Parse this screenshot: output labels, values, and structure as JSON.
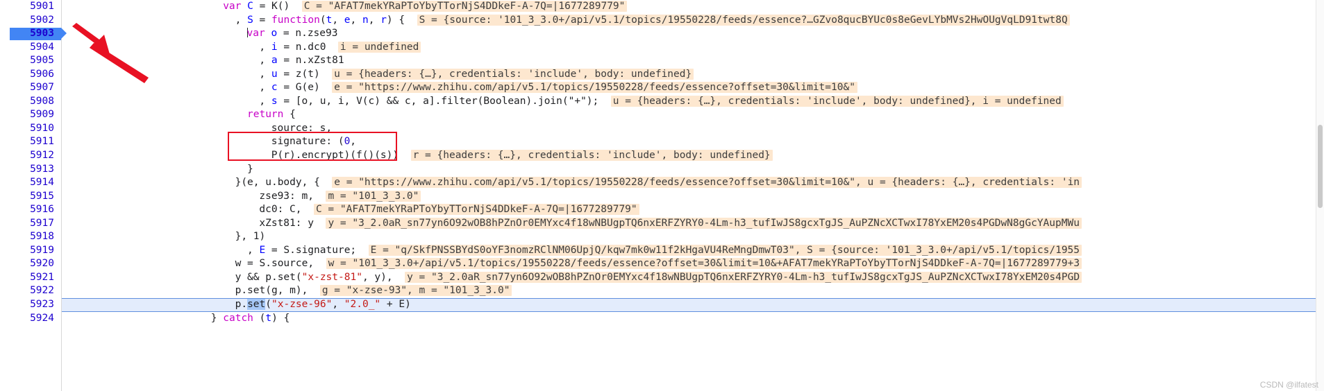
{
  "app": {
    "name": "Chrome DevTools Sources Panel",
    "watermark": "CSDN @ilfatest"
  },
  "editor": {
    "first_line": 5901,
    "current_line": 5923,
    "arrow_target_line": 5903,
    "highlight_box_lines": [
      5911,
      5912
    ],
    "accent_color": "#4285f4",
    "hint_bg": "#fde7cf",
    "selection_color": "#a6c8f7",
    "annotation_color": "#e81123",
    "gutter_numbers": [
      "5901",
      "5902",
      "5903",
      "5904",
      "5905",
      "5906",
      "5907",
      "5908",
      "5909",
      "5910",
      "5911",
      "5912",
      "5913",
      "5914",
      "5915",
      "5916",
      "5917",
      "5918",
      "5919",
      "5920",
      "5921",
      "5922",
      "5923",
      "5924"
    ],
    "lines": [
      {
        "n": "5901",
        "indent": 26,
        "tokens": [
          {
            "t": "kw",
            "v": "var"
          },
          {
            "t": "plain",
            "v": " "
          },
          {
            "t": "var",
            "v": "C"
          },
          {
            "t": "plain",
            "v": " = K()"
          }
        ],
        "hint": "C = \"AFAT7mekYRaPToYbyTTorNjS4DDkeF-A-7Q=|1677289779\""
      },
      {
        "n": "5902",
        "indent": 28,
        "tokens": [
          {
            "t": "plain",
            "v": ", "
          },
          {
            "t": "var",
            "v": "S"
          },
          {
            "t": "plain",
            "v": " = "
          },
          {
            "t": "kw",
            "v": "function"
          },
          {
            "t": "plain",
            "v": "("
          },
          {
            "t": "var",
            "v": "t"
          },
          {
            "t": "plain",
            "v": ", "
          },
          {
            "t": "var",
            "v": "e"
          },
          {
            "t": "plain",
            "v": ", "
          },
          {
            "t": "var",
            "v": "n"
          },
          {
            "t": "plain",
            "v": ", "
          },
          {
            "t": "var",
            "v": "r"
          },
          {
            "t": "plain",
            "v": ") {"
          }
        ],
        "hint": "S = {source: '101_3_3.0+/api/v5.1/topics/19550228/feeds/essence?…GZvo8qucBYUc0s8eGevLYbMVs2HwOUgVqLD91twt8Q"
      },
      {
        "n": "5903",
        "indent": 30,
        "caret": true,
        "tokens": [
          {
            "t": "kw",
            "v": "var"
          },
          {
            "t": "plain",
            "v": " "
          },
          {
            "t": "var",
            "v": "o"
          },
          {
            "t": "plain",
            "v": " = n.zse93"
          }
        ],
        "hint": ""
      },
      {
        "n": "5904",
        "indent": 32,
        "tokens": [
          {
            "t": "plain",
            "v": ", "
          },
          {
            "t": "var",
            "v": "i"
          },
          {
            "t": "plain",
            "v": " = n.dc0"
          }
        ],
        "hint": "i = undefined"
      },
      {
        "n": "5905",
        "indent": 32,
        "tokens": [
          {
            "t": "plain",
            "v": ", "
          },
          {
            "t": "var",
            "v": "a"
          },
          {
            "t": "plain",
            "v": " = n.xZst81"
          }
        ],
        "hint": ""
      },
      {
        "n": "5906",
        "indent": 32,
        "tokens": [
          {
            "t": "plain",
            "v": ", "
          },
          {
            "t": "var",
            "v": "u"
          },
          {
            "t": "plain",
            "v": " = z(t)"
          }
        ],
        "hint": "u = {headers: {…}, credentials: 'include', body: undefined}"
      },
      {
        "n": "5907",
        "indent": 32,
        "tokens": [
          {
            "t": "plain",
            "v": ", "
          },
          {
            "t": "var",
            "v": "c"
          },
          {
            "t": "plain",
            "v": " = G(e)"
          }
        ],
        "hint": "e = \"https://www.zhihu.com/api/v5.1/topics/19550228/feeds/essence?offset=30&limit=10&\""
      },
      {
        "n": "5908",
        "indent": 32,
        "tokens": [
          {
            "t": "plain",
            "v": ", "
          },
          {
            "t": "var",
            "v": "s"
          },
          {
            "t": "plain",
            "v": " = [o, u, i, V(c) && c, a].filter(Boolean).join(\"+\");"
          }
        ],
        "hint": "u = {headers: {…}, credentials: 'include', body: undefined}, i = undefined"
      },
      {
        "n": "5909",
        "indent": 30,
        "tokens": [
          {
            "t": "kw",
            "v": "return"
          },
          {
            "t": "plain",
            "v": " {"
          }
        ],
        "hint": ""
      },
      {
        "n": "5910",
        "indent": 34,
        "tokens": [
          {
            "t": "plain",
            "v": "source: s,"
          }
        ],
        "hint": ""
      },
      {
        "n": "5911",
        "indent": 34,
        "tokens": [
          {
            "t": "plain",
            "v": "signature: ("
          },
          {
            "t": "num",
            "v": "0"
          },
          {
            "t": "plain",
            "v": ","
          }
        ],
        "hint": ""
      },
      {
        "n": "5912",
        "indent": 34,
        "tokens": [
          {
            "t": "plain",
            "v": "P(r).encrypt)(f()(s))"
          }
        ],
        "hint": "r = {headers: {…}, credentials: 'include', body: undefined}"
      },
      {
        "n": "5913",
        "indent": 30,
        "tokens": [
          {
            "t": "plain",
            "v": "}"
          }
        ],
        "hint": ""
      },
      {
        "n": "5914",
        "indent": 28,
        "tokens": [
          {
            "t": "plain",
            "v": "}(e, u.body, {"
          }
        ],
        "hint": "e = \"https://www.zhihu.com/api/v5.1/topics/19550228/feeds/essence?offset=30&limit=10&\", u = {headers: {…}, credentials: 'in"
      },
      {
        "n": "5915",
        "indent": 32,
        "tokens": [
          {
            "t": "plain",
            "v": "zse93: m,"
          }
        ],
        "hint": "m = \"101_3_3.0\""
      },
      {
        "n": "5916",
        "indent": 32,
        "tokens": [
          {
            "t": "plain",
            "v": "dc0: C,"
          }
        ],
        "hint": "C = \"AFAT7mekYRaPToYbyTTorNjS4DDkeF-A-7Q=|1677289779\""
      },
      {
        "n": "5917",
        "indent": 32,
        "tokens": [
          {
            "t": "plain",
            "v": "xZst81: y"
          }
        ],
        "hint": "y = \"3_2.0aR_sn77yn6O92wOB8hPZnOr0EMYxc4f18wNBUgpTQ6nxERFZYRY0-4Lm-h3_tufIwJS8gcxTgJS_AuPZNcXCTwxI78YxEM20s4PGDwN8gGcYAupMWu"
      },
      {
        "n": "5918",
        "indent": 28,
        "tokens": [
          {
            "t": "plain",
            "v": "}, 1)"
          }
        ],
        "hint": ""
      },
      {
        "n": "5919",
        "indent": 30,
        "tokens": [
          {
            "t": "plain",
            "v": ", "
          },
          {
            "t": "var",
            "v": "E"
          },
          {
            "t": "plain",
            "v": " = S.signature;"
          }
        ],
        "hint": "E = \"q/SkfPNSSBYdS0oYF3nomzRClNM06UpjQ/kqw7mk0w11f2kHgaVU4ReMngDmwT03\", S = {source: '101_3_3.0+/api/v5.1/topics/1955"
      },
      {
        "n": "5920",
        "indent": 28,
        "tokens": [
          {
            "t": "plain",
            "v": "w = S.source,"
          }
        ],
        "hint": "w = \"101_3_3.0+/api/v5.1/topics/19550228/feeds/essence?offset=30&limit=10&+AFAT7mekYRaPToYbyTTorNjS4DDkeF-A-7Q=|1677289779+3"
      },
      {
        "n": "5921",
        "indent": 28,
        "tokens": [
          {
            "t": "plain",
            "v": "y && p.set("
          },
          {
            "t": "str",
            "v": "\"x-zst-81\""
          },
          {
            "t": "plain",
            "v": ", y),"
          }
        ],
        "hint": "y = \"3_2.0aR_sn77yn6O92wOB8hPZnOr0EMYxc4f18wNBUgpTQ6nxERFZYRY0-4Lm-h3_tufIwJS8gcxTgJS_AuPZNcXCTwxI78YxEM20s4PGD"
      },
      {
        "n": "5922",
        "indent": 28,
        "tokens": [
          {
            "t": "plain",
            "v": "p.set(g, m),"
          }
        ],
        "hint": "g = \"x-zse-93\", m = \"101_3_3.0\""
      },
      {
        "n": "5923",
        "indent": 28,
        "current": true,
        "tokens": [
          {
            "t": "plain",
            "v": "p."
          },
          {
            "t": "sel",
            "v": "set"
          },
          {
            "t": "plain",
            "v": "("
          },
          {
            "t": "str",
            "v": "\"x-zse-96\""
          },
          {
            "t": "plain",
            "v": ", "
          },
          {
            "t": "str",
            "v": "\"2.0_\""
          },
          {
            "t": "plain",
            "v": " + E)"
          }
        ],
        "hint": ""
      },
      {
        "n": "5924",
        "indent": 24,
        "tokens": [
          {
            "t": "plain",
            "v": "} "
          },
          {
            "t": "kw",
            "v": "catch"
          },
          {
            "t": "plain",
            "v": " ("
          },
          {
            "t": "var",
            "v": "t"
          },
          {
            "t": "plain",
            "v": ") {"
          }
        ],
        "hint": ""
      }
    ]
  },
  "annotations": {
    "arrow": {
      "name": "red-arrow",
      "points_to_line": "5903",
      "color": "#e81123"
    },
    "box": {
      "name": "red-rectangle",
      "covers": "signature: (0, P(r).encrypt)(f()(s))",
      "color": "#e81123"
    }
  }
}
